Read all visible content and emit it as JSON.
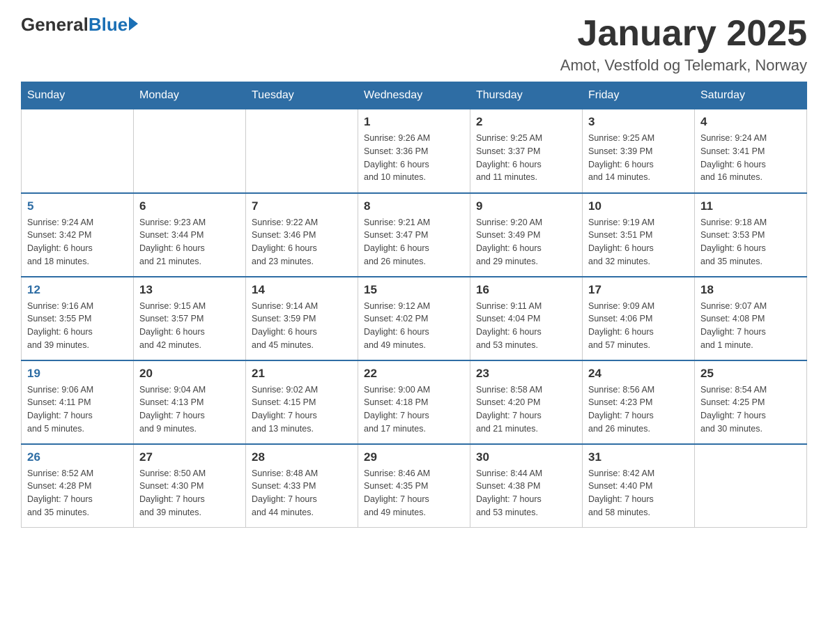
{
  "logo": {
    "general": "General",
    "blue": "Blue"
  },
  "header": {
    "month": "January 2025",
    "location": "Amot, Vestfold og Telemark, Norway"
  },
  "weekdays": [
    "Sunday",
    "Monday",
    "Tuesday",
    "Wednesday",
    "Thursday",
    "Friday",
    "Saturday"
  ],
  "weeks": [
    [
      {
        "day": "",
        "info": ""
      },
      {
        "day": "",
        "info": ""
      },
      {
        "day": "",
        "info": ""
      },
      {
        "day": "1",
        "info": "Sunrise: 9:26 AM\nSunset: 3:36 PM\nDaylight: 6 hours\nand 10 minutes."
      },
      {
        "day": "2",
        "info": "Sunrise: 9:25 AM\nSunset: 3:37 PM\nDaylight: 6 hours\nand 11 minutes."
      },
      {
        "day": "3",
        "info": "Sunrise: 9:25 AM\nSunset: 3:39 PM\nDaylight: 6 hours\nand 14 minutes."
      },
      {
        "day": "4",
        "info": "Sunrise: 9:24 AM\nSunset: 3:41 PM\nDaylight: 6 hours\nand 16 minutes."
      }
    ],
    [
      {
        "day": "5",
        "info": "Sunrise: 9:24 AM\nSunset: 3:42 PM\nDaylight: 6 hours\nand 18 minutes."
      },
      {
        "day": "6",
        "info": "Sunrise: 9:23 AM\nSunset: 3:44 PM\nDaylight: 6 hours\nand 21 minutes."
      },
      {
        "day": "7",
        "info": "Sunrise: 9:22 AM\nSunset: 3:46 PM\nDaylight: 6 hours\nand 23 minutes."
      },
      {
        "day": "8",
        "info": "Sunrise: 9:21 AM\nSunset: 3:47 PM\nDaylight: 6 hours\nand 26 minutes."
      },
      {
        "day": "9",
        "info": "Sunrise: 9:20 AM\nSunset: 3:49 PM\nDaylight: 6 hours\nand 29 minutes."
      },
      {
        "day": "10",
        "info": "Sunrise: 9:19 AM\nSunset: 3:51 PM\nDaylight: 6 hours\nand 32 minutes."
      },
      {
        "day": "11",
        "info": "Sunrise: 9:18 AM\nSunset: 3:53 PM\nDaylight: 6 hours\nand 35 minutes."
      }
    ],
    [
      {
        "day": "12",
        "info": "Sunrise: 9:16 AM\nSunset: 3:55 PM\nDaylight: 6 hours\nand 39 minutes."
      },
      {
        "day": "13",
        "info": "Sunrise: 9:15 AM\nSunset: 3:57 PM\nDaylight: 6 hours\nand 42 minutes."
      },
      {
        "day": "14",
        "info": "Sunrise: 9:14 AM\nSunset: 3:59 PM\nDaylight: 6 hours\nand 45 minutes."
      },
      {
        "day": "15",
        "info": "Sunrise: 9:12 AM\nSunset: 4:02 PM\nDaylight: 6 hours\nand 49 minutes."
      },
      {
        "day": "16",
        "info": "Sunrise: 9:11 AM\nSunset: 4:04 PM\nDaylight: 6 hours\nand 53 minutes."
      },
      {
        "day": "17",
        "info": "Sunrise: 9:09 AM\nSunset: 4:06 PM\nDaylight: 6 hours\nand 57 minutes."
      },
      {
        "day": "18",
        "info": "Sunrise: 9:07 AM\nSunset: 4:08 PM\nDaylight: 7 hours\nand 1 minute."
      }
    ],
    [
      {
        "day": "19",
        "info": "Sunrise: 9:06 AM\nSunset: 4:11 PM\nDaylight: 7 hours\nand 5 minutes."
      },
      {
        "day": "20",
        "info": "Sunrise: 9:04 AM\nSunset: 4:13 PM\nDaylight: 7 hours\nand 9 minutes."
      },
      {
        "day": "21",
        "info": "Sunrise: 9:02 AM\nSunset: 4:15 PM\nDaylight: 7 hours\nand 13 minutes."
      },
      {
        "day": "22",
        "info": "Sunrise: 9:00 AM\nSunset: 4:18 PM\nDaylight: 7 hours\nand 17 minutes."
      },
      {
        "day": "23",
        "info": "Sunrise: 8:58 AM\nSunset: 4:20 PM\nDaylight: 7 hours\nand 21 minutes."
      },
      {
        "day": "24",
        "info": "Sunrise: 8:56 AM\nSunset: 4:23 PM\nDaylight: 7 hours\nand 26 minutes."
      },
      {
        "day": "25",
        "info": "Sunrise: 8:54 AM\nSunset: 4:25 PM\nDaylight: 7 hours\nand 30 minutes."
      }
    ],
    [
      {
        "day": "26",
        "info": "Sunrise: 8:52 AM\nSunset: 4:28 PM\nDaylight: 7 hours\nand 35 minutes."
      },
      {
        "day": "27",
        "info": "Sunrise: 8:50 AM\nSunset: 4:30 PM\nDaylight: 7 hours\nand 39 minutes."
      },
      {
        "day": "28",
        "info": "Sunrise: 8:48 AM\nSunset: 4:33 PM\nDaylight: 7 hours\nand 44 minutes."
      },
      {
        "day": "29",
        "info": "Sunrise: 8:46 AM\nSunset: 4:35 PM\nDaylight: 7 hours\nand 49 minutes."
      },
      {
        "day": "30",
        "info": "Sunrise: 8:44 AM\nSunset: 4:38 PM\nDaylight: 7 hours\nand 53 minutes."
      },
      {
        "day": "31",
        "info": "Sunrise: 8:42 AM\nSunset: 4:40 PM\nDaylight: 7 hours\nand 58 minutes."
      },
      {
        "day": "",
        "info": ""
      }
    ]
  ]
}
